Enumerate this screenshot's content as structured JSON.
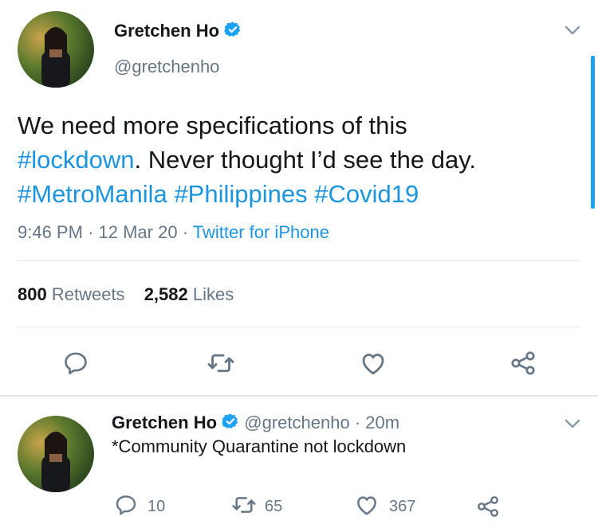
{
  "main_tweet": {
    "author_name": "Gretchen Ho",
    "handle": "@gretchenho",
    "text_plain_1": "We need more specifications of this",
    "hashtag_lockdown": "#lockdown",
    "text_plain_2": ". Never thought I’d see the day.",
    "hashtag_1": "#MetroManila",
    "hashtag_2": "#Philippines",
    "hashtag_3": "#Covid19",
    "time": "9:46 PM",
    "sep1": "·",
    "date": "12 Mar 20",
    "sep2": "·",
    "source": "Twitter for iPhone",
    "retweets_count": "800",
    "retweets_label": "Retweets",
    "likes_count": "2,582",
    "likes_label": "Likes"
  },
  "reply_tweet": {
    "author_name": "Gretchen Ho",
    "handle": "@gretchenho",
    "sep": "·",
    "age": "20m",
    "text": "*Community Quarantine not lockdown",
    "reply_count": "10",
    "retweet_count": "65",
    "like_count": "367"
  },
  "colors": {
    "link": "#1b95e0",
    "muted": "#657786",
    "verified": "#1da1f2",
    "icon": "#657786"
  },
  "icons": [
    "chevron-down-icon",
    "verified-badge-icon",
    "reply-icon",
    "retweet-icon",
    "like-icon",
    "share-icon"
  ]
}
